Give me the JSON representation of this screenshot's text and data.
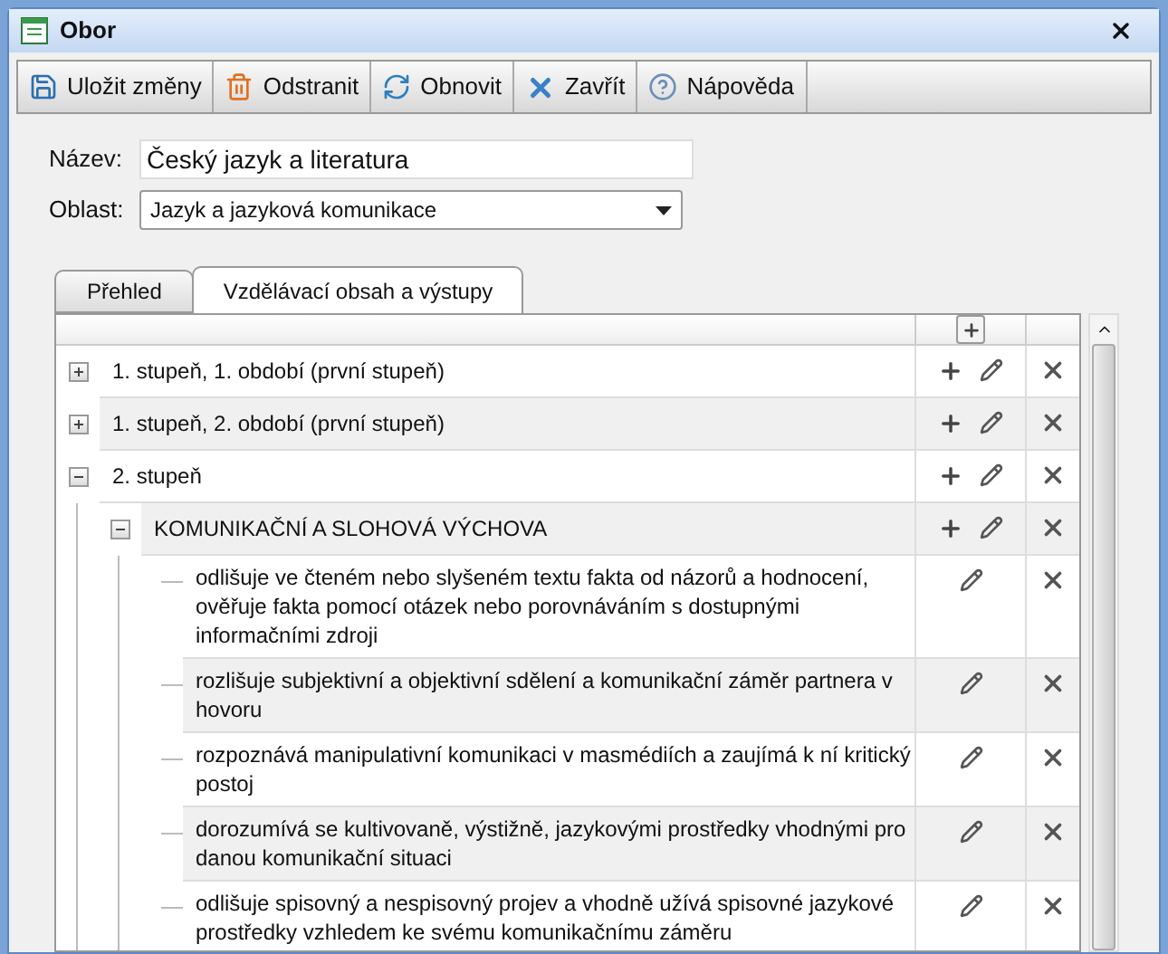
{
  "window": {
    "title": "Obor"
  },
  "toolbar": [
    {
      "label": "Uložit změny",
      "kind": "save"
    },
    {
      "label": "Odstranit",
      "kind": "delete"
    },
    {
      "label": "Obnovit",
      "kind": "refresh"
    },
    {
      "label": "Zavřít",
      "kind": "close"
    },
    {
      "label": "Nápověda",
      "kind": "help"
    }
  ],
  "form": {
    "name_label": "Název:",
    "name_value": "Český jazyk a literatura",
    "area_label": "Oblast:",
    "area_value": "Jazyk a jazyková komunikace"
  },
  "tabs": [
    {
      "label": "Přehled",
      "selected": false
    },
    {
      "label": "Vzdělávací obsah a výstupy",
      "selected": true
    }
  ],
  "tree": [
    {
      "label": "1. stupeň, 1. období (první stupeň)",
      "expanded": false,
      "kind": "group"
    },
    {
      "label": "1. stupeň, 2. období (první stupeň)",
      "expanded": false,
      "kind": "group"
    },
    {
      "label": "2. stupeň",
      "expanded": true,
      "kind": "group",
      "children": [
        {
          "label": "KOMUNIKAČNÍ A SLOHOVÁ VÝCHOVA",
          "expanded": true,
          "kind": "group",
          "children": [
            {
              "label": "odlišuje ve čteném nebo slyšeném textu fakta od názorů a hodnocení, ověřuje fakta pomocí otázek nebo porovnáváním s dostupnými informačními zdroji",
              "kind": "leaf"
            },
            {
              "label": "rozlišuje subjektivní a objektivní sdělení a komunikační záměr partnera v hovoru",
              "kind": "leaf"
            },
            {
              "label": "rozpoznává manipulativní komunikaci v masmédiích a zaujímá k ní kritický postoj",
              "kind": "leaf"
            },
            {
              "label": "dorozumívá se kultivovaně, výstižně, jazykovými prostředky vhodnými pro danou komunikační situaci",
              "kind": "leaf"
            },
            {
              "label": "odlišuje spisovný a nespisovný projev a vhodně užívá spisovné jazykové prostředky vzhledem ke svému komunikačnímu záměru",
              "kind": "leaf"
            }
          ]
        }
      ]
    }
  ]
}
